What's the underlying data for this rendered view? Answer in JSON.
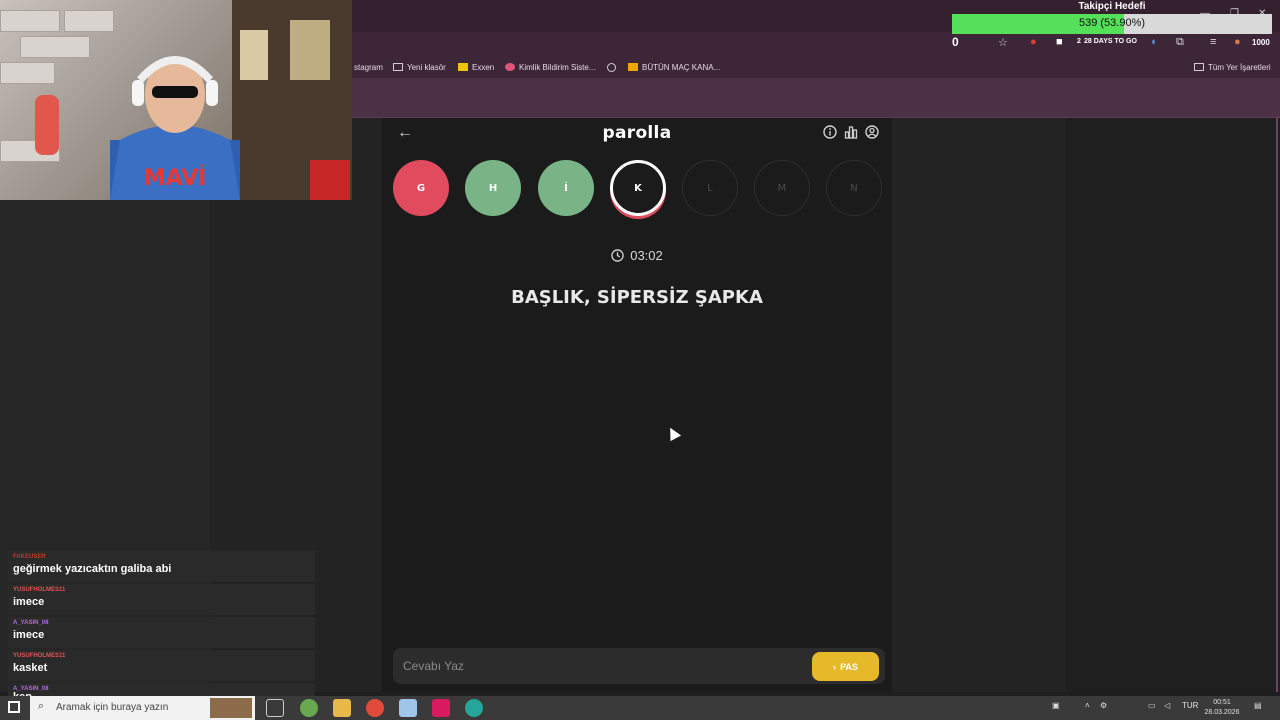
{
  "bookmarks": [
    {
      "label": "stagram",
      "color": "#e4405f"
    },
    {
      "label": "Yeni klasör",
      "color": "#cfcfcf"
    },
    {
      "label": "Exxen",
      "color": "#f2c400"
    },
    {
      "label": "Kimlik Bildirim Siste...",
      "color": "#e05577"
    },
    {
      "label": "",
      "color": "#cfcfcf"
    },
    {
      "label": "BÜTÜN MAÇ KANA...",
      "color": "#f0a500"
    }
  ],
  "bookmarks_right": "Tüm Yer İşaretleri",
  "toolbar_badge": "2",
  "toolbar_extension_text": "28 DAYS TO GO",
  "toolbar_count": "1000",
  "app": {
    "title": "parolla",
    "letters": [
      {
        "letter": "G",
        "state": "wrong"
      },
      {
        "letter": "H",
        "state": "correct"
      },
      {
        "letter": "İ",
        "state": "correct"
      },
      {
        "letter": "K",
        "state": "current"
      },
      {
        "letter": "L",
        "state": "pending"
      },
      {
        "letter": "M",
        "state": "pending"
      },
      {
        "letter": "N",
        "state": "pending"
      }
    ],
    "timer": "03:02",
    "question": "BAŞLIK, SİPERSİZ ŞAPKA",
    "answer_placeholder": "Cevabı Yaz",
    "pass_label": "PAS"
  },
  "goal": {
    "title": "Takipçi Hedefi",
    "progress_text": "539 (53.90%)",
    "progress": 0.539,
    "counter": "0"
  },
  "chat": [
    {
      "user": "FAKEUSER",
      "user_color": "#c0392b",
      "text": "geğirmek yazıcaktın galiba abi"
    },
    {
      "user": "YUSUFHOLMES11",
      "user_color": "#e05555",
      "text": "imece"
    },
    {
      "user": "A_YASIN_08",
      "user_color": "#b06cd6",
      "text": "imece"
    },
    {
      "user": "YUSUFHOLMES11",
      "user_color": "#e05555",
      "text": "kasket"
    },
    {
      "user": "A_YASIN_08",
      "user_color": "#b06cd6",
      "text": "kep"
    }
  ],
  "taskbar": {
    "search_placeholder": "Aramak için buraya yazın",
    "language": "TUR",
    "time": "00:51",
    "date": "28.03.2026"
  }
}
